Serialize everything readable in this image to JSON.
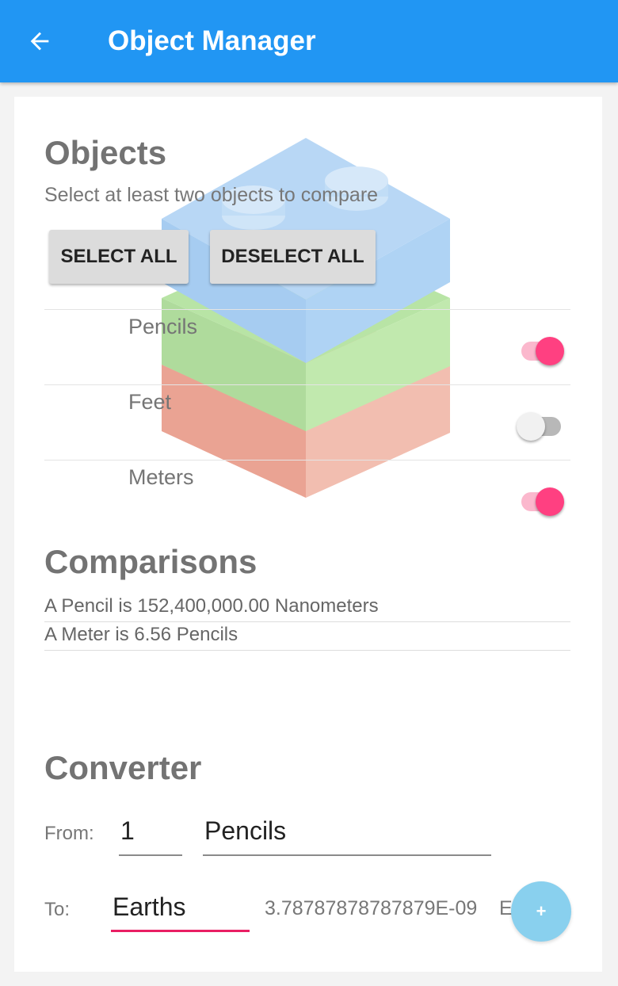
{
  "appbar": {
    "title": "Object Manager",
    "back_icon": "arrow-left-icon"
  },
  "objects": {
    "heading": "Objects",
    "subtitle": "Select at least two objects to compare",
    "select_all": "SELECT ALL",
    "deselect_all": "DESELECT ALL",
    "items": [
      {
        "label": "Pencils",
        "enabled": true
      },
      {
        "label": "Feet",
        "enabled": false
      },
      {
        "label": "Meters",
        "enabled": true
      }
    ]
  },
  "comparisons": {
    "heading": "Comparisons",
    "lines": [
      "A Pencil is 152,400,000.00 Nanometers",
      "A Meter is 6.56 Pencils"
    ]
  },
  "converter": {
    "heading": "Converter",
    "from_label": "From:",
    "from_value": "1",
    "from_unit": "Pencils",
    "to_label": "To:",
    "to_unit": "Earths",
    "result": "3.78787878787879E-09",
    "result_unit": "E",
    "fab_label": "+"
  },
  "colors": {
    "primary": "#2196f3",
    "accent": "#ff4081",
    "logo_top": "#6fb0ec",
    "logo_middle": "#7fcf5c",
    "logo_bottom": "#e06a4d"
  }
}
